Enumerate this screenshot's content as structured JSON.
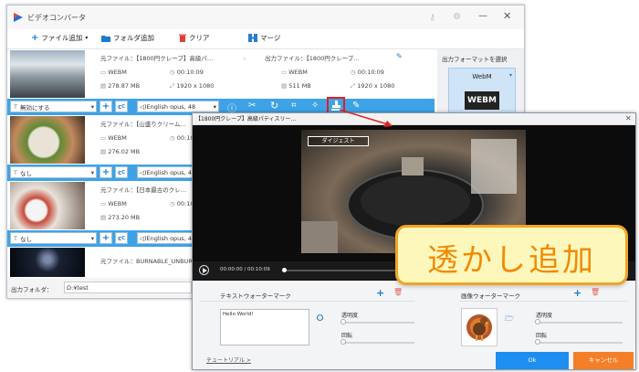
{
  "app": {
    "title": "ビデオコンバータ"
  },
  "toolbar": {
    "add_file": "ファイル追加",
    "add_folder": "フォルダ追加",
    "clear": "クリア",
    "merge": "マージ"
  },
  "labels": {
    "source": "元ファイル：",
    "output": "出力ファイル：",
    "output_format_heading": "出力フォーマットを選択",
    "output_folder": "出力フォルダ："
  },
  "files": [
    {
      "src_name": "【1800円クレープ】高級パ…",
      "format": "WEBM",
      "duration": "00:10:09",
      "size": "278.87 MB",
      "resolution": "1920 x 1080",
      "out_name": "【1800円クレープ…",
      "out_format": "WEBM",
      "out_duration": "00:10:09",
      "out_size": "511 MB",
      "out_resolution": "1920 x 1080",
      "subtitle": "無効にする",
      "audio": "English opus, 48"
    },
    {
      "src_name": "【山盛りクリーム…",
      "format": "WEBM",
      "duration": "00:10:09",
      "size": "276.02 MB",
      "subtitle": "なし",
      "audio": "English opus, 4"
    },
    {
      "src_name": "【日本最古のクレ…",
      "format": "WEBM",
      "duration": "00:10:09",
      "size": "273.20 MB",
      "subtitle": "なし",
      "audio": "English opus, 4"
    },
    {
      "src_name": "BURNABLE_UNBURN…"
    }
  ],
  "format_panel": {
    "name": "WebM",
    "badge": "WEBM"
  },
  "footer": {
    "folder_value": "D:¥test"
  },
  "dialog": {
    "title": "【1800円クレープ】高級パティスリー…",
    "caption": "ダイジェスト",
    "time": "00:00:00 / 00:10:09",
    "text_watermark_heading": "テキストウォーターマーク",
    "text_value": "Hello World!",
    "image_watermark_heading": "画像ウォーターマーク",
    "opacity_label": "透明度",
    "rotate_label": "回転",
    "tutorial_link": "チュートリアル >",
    "ok_label": "Ok",
    "cancel_label": "キャンセル"
  },
  "callout": {
    "text": "透かし追加"
  },
  "colors": {
    "accent_blue": "#3ea3e6",
    "highlight_red": "#e02020",
    "callout_fill": "#fef7bc",
    "callout_text": "#f08a00",
    "cancel_orange": "#f47f28",
    "ok_blue": "#1e8ff0"
  }
}
